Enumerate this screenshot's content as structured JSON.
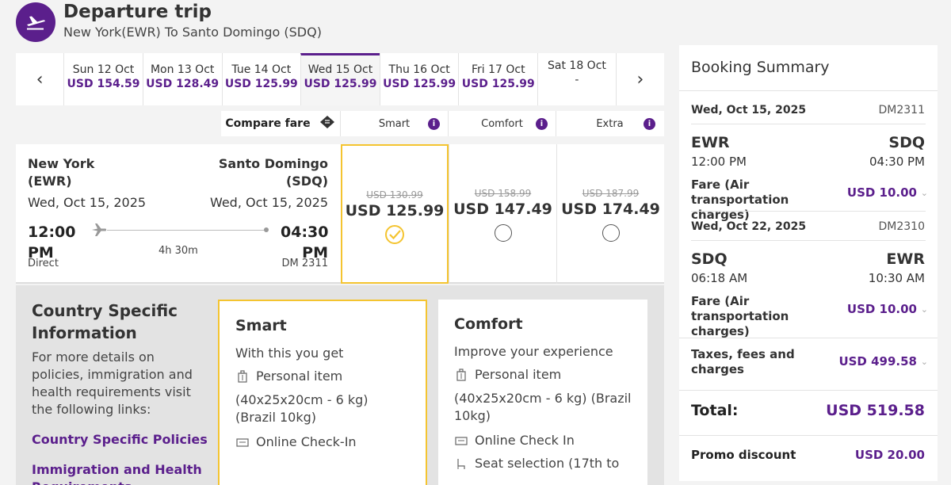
{
  "header": {
    "title": "Departure trip",
    "route": "New York(EWR) To Santo Domingo (SDQ)"
  },
  "dates": [
    {
      "label": "Sun 12 Oct",
      "price": "USD 154.59"
    },
    {
      "label": "Mon 13 Oct",
      "price": "USD 128.49"
    },
    {
      "label": "Tue 14 Oct",
      "price": "USD 125.99"
    },
    {
      "label": "Wed 15 Oct",
      "price": "USD 125.99",
      "active": true
    },
    {
      "label": "Thu 16 Oct",
      "price": "USD 125.99"
    },
    {
      "label": "Fri 17 Oct",
      "price": "USD 125.99"
    },
    {
      "label": "Sat 18 Oct",
      "price": "-"
    }
  ],
  "compare": {
    "label": "Compare fare",
    "smart": "Smart",
    "comfort": "Comfort",
    "extra": "Extra",
    "info": "i"
  },
  "flight": {
    "from_city": "New York",
    "from_code": "(EWR)",
    "to_city": "Santo Domingo",
    "to_code": "(SDQ)",
    "from_date": "Wed, Oct 15, 2025",
    "to_date": "Wed, Oct 15, 2025",
    "dep_time": "12:00 PM",
    "arr_time": "04:30 PM",
    "duration": "4h 30m",
    "stops": "Direct",
    "flight_no": "DM 2311"
  },
  "fares": {
    "smart": {
      "old": "USD 130.99",
      "new": "USD 125.99"
    },
    "comfort": {
      "old": "USD 158.99",
      "new": "USD 147.49"
    },
    "extra": {
      "old": "USD 187.99",
      "new": "USD 174.49"
    }
  },
  "country_info": {
    "title": "Country Specific Information",
    "text": "For more details on policies, immigration and health requirements visit the following links:",
    "link1": "Country Specific Policies",
    "link2": "Immigration and Health Requirements"
  },
  "bundles": {
    "smart": {
      "title": "Smart",
      "sub": "With this you get",
      "item1": "Personal item",
      "dims": "(40x25x20cm - 6 kg) (Brazil 10kg)",
      "item2": "Online Check-In"
    },
    "comfort": {
      "title": "Comfort",
      "sub": "Improve your experience",
      "item1": "Personal item",
      "dims": "(40x25x20cm - 6 kg) (Brazil 10kg)",
      "item2": "Online Check In",
      "item3": "Seat selection (17th to"
    }
  },
  "summary": {
    "title": "Booking Summary",
    "leg1": {
      "date": "Wed, Oct 15, 2025",
      "flight_no": "DM2311",
      "from": "EWR",
      "to": "SDQ",
      "dep": "12:00 PM",
      "arr": "04:30 PM",
      "fare_label": "Fare (Air transportation charges)",
      "fare": "USD 10.00"
    },
    "leg2": {
      "date": "Wed, Oct 22, 2025",
      "flight_no": "DM2310",
      "from": "SDQ",
      "to": "EWR",
      "dep": "06:18 AM",
      "arr": "10:30 AM",
      "fare_label": "Fare (Air transportation charges)",
      "fare": "USD 10.00"
    },
    "taxes_label": "Taxes, fees and charges",
    "taxes": "USD 499.58",
    "total_label": "Total:",
    "total": "USD 519.58",
    "promo_label": "Promo discount",
    "promo": "USD 20.00"
  },
  "colors": {
    "brand": "#5b1f8c",
    "selected": "#f4c430"
  }
}
